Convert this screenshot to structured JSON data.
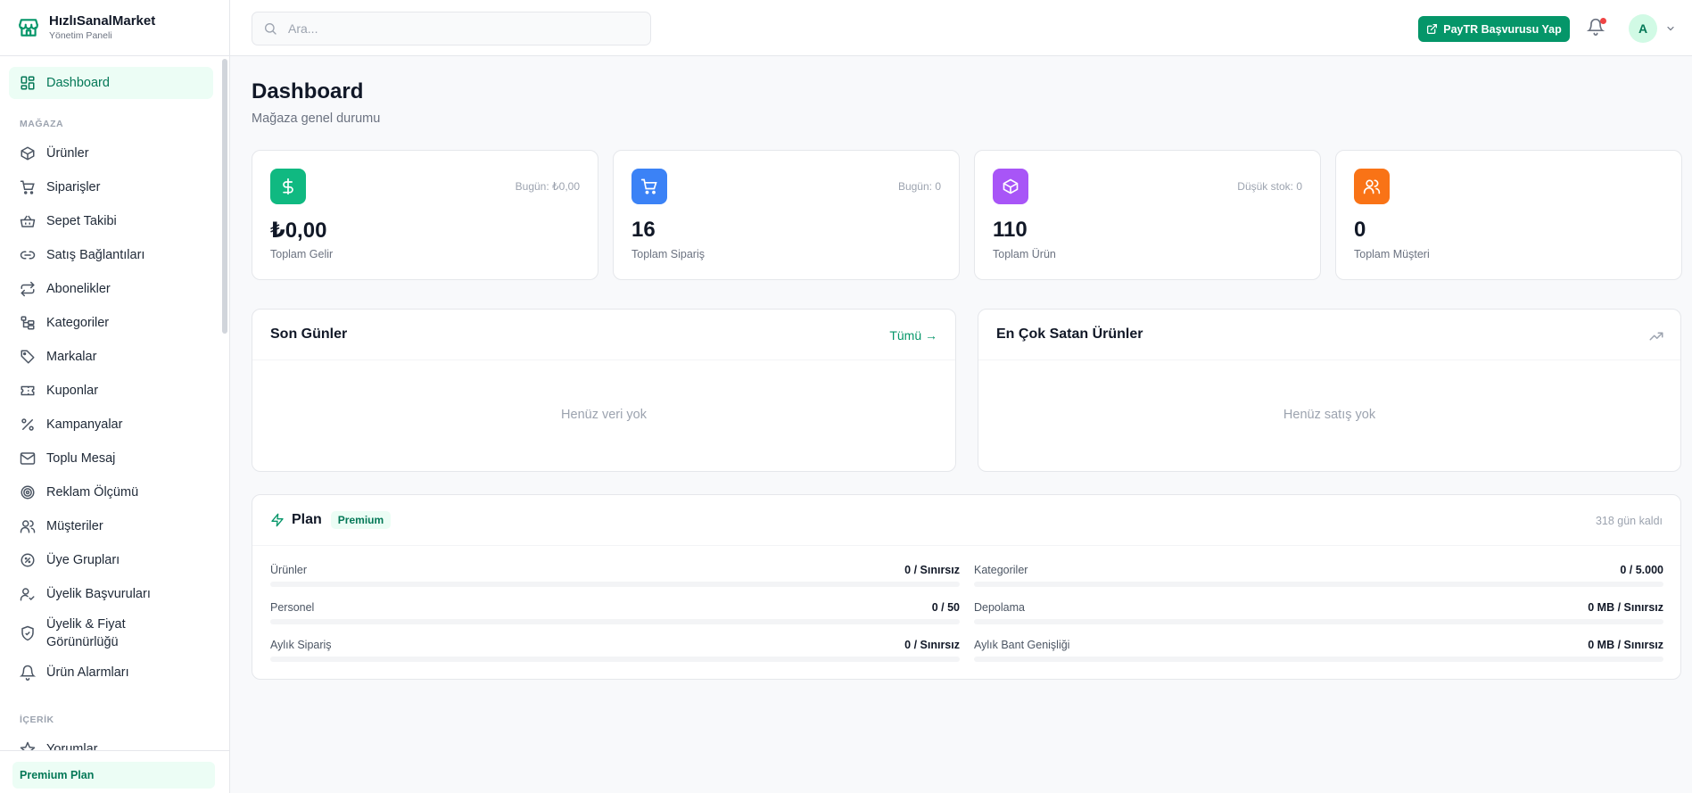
{
  "brand": {
    "name": "HızlıSanalMarket",
    "subtitle": "Yönetim Paneli"
  },
  "sidebar": {
    "dashboard": "Dashboard",
    "section_store": "MAĞAZA",
    "items": [
      {
        "label": "Ürünler",
        "icon": "box-icon"
      },
      {
        "label": "Siparişler",
        "icon": "cart-icon"
      },
      {
        "label": "Sepet Takibi",
        "icon": "basket-icon"
      },
      {
        "label": "Satış Bağlantıları",
        "icon": "link-icon"
      },
      {
        "label": "Abonelikler",
        "icon": "repeat-icon"
      },
      {
        "label": "Kategoriler",
        "icon": "folder-tree-icon"
      },
      {
        "label": "Markalar",
        "icon": "tag-icon"
      },
      {
        "label": "Kuponlar",
        "icon": "ticket-icon"
      },
      {
        "label": "Kampanyalar",
        "icon": "percent-icon"
      },
      {
        "label": "Toplu Mesaj",
        "icon": "mail-icon"
      },
      {
        "label": "Reklam Ölçümü",
        "icon": "target-icon"
      },
      {
        "label": "Müşteriler",
        "icon": "users-icon"
      },
      {
        "label": "Üye Grupları",
        "icon": "badge-percent-icon"
      },
      {
        "label": "Üyelik Başvuruları",
        "icon": "user-check-icon"
      },
      {
        "label": "Üyelik & Fiyat Görünürlüğü",
        "icon": "shield-check-icon"
      },
      {
        "label": "Ürün Alarmları",
        "icon": "bell-icon"
      }
    ],
    "section_content": "İÇERİK",
    "partial_item": "Yorumlar",
    "footer_plan": "Premium Plan"
  },
  "header": {
    "search_placeholder": "Ara...",
    "paytr_button": "PayTR Başvurusu Yap",
    "avatar_initial": "A"
  },
  "page": {
    "title": "Dashboard",
    "subtitle": "Mağaza genel durumu"
  },
  "stats": [
    {
      "value": "₺0,00",
      "label": "Toplam Gelir",
      "meta": "Bugün: ₺0,00",
      "icon": "dollar-icon",
      "color": "#10b981"
    },
    {
      "value": "16",
      "label": "Toplam Sipariş",
      "meta": "Bugün: 0",
      "icon": "cart-icon",
      "color": "#3b82f6"
    },
    {
      "value": "110",
      "label": "Toplam Ürün",
      "meta": "Düşük stok: 0",
      "icon": "box-icon",
      "color": "#a855f7"
    },
    {
      "value": "0",
      "label": "Toplam Müşteri",
      "meta": "",
      "icon": "users-icon",
      "color": "#f97316"
    }
  ],
  "recent": {
    "title": "Son Günler",
    "link": "Tümü →",
    "empty": "Henüz veri yok"
  },
  "top_products": {
    "title": "En Çok Satan Ürünler",
    "empty": "Henüz satış yok"
  },
  "plan": {
    "title": "Plan",
    "badge": "Premium",
    "days_left": "318 gün kaldı",
    "quotas": [
      {
        "label": "Ürünler",
        "value": "0 / Sınırsız",
        "fill": 0
      },
      {
        "label": "Kategoriler",
        "value": "0 / 5.000",
        "fill": 0
      },
      {
        "label": "Personel",
        "value": "0 / 50",
        "fill": 0
      },
      {
        "label": "Depolama",
        "value": "0 MB / Sınırsız",
        "fill": 0
      },
      {
        "label": "Aylık Sipariş",
        "value": "0 / Sınırsız",
        "fill": 0
      },
      {
        "label": "Aylık Bant Genişliği",
        "value": "0 MB / Sınırsız",
        "fill": 0
      }
    ]
  }
}
